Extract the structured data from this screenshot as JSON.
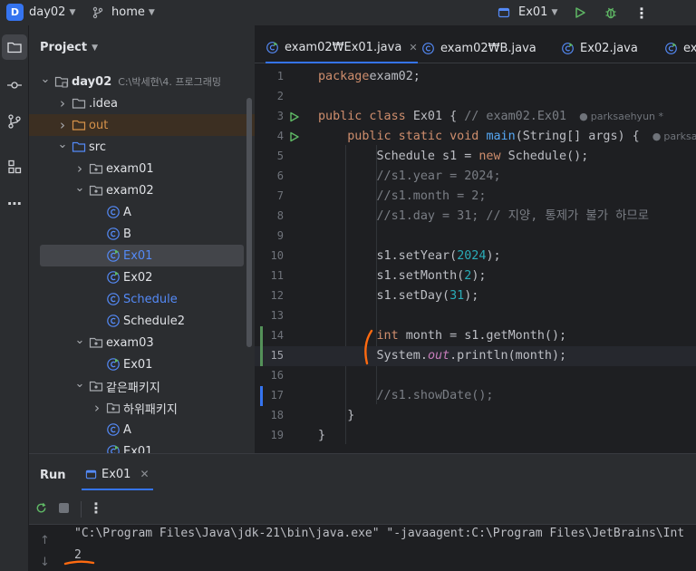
{
  "titlebar": {
    "project_badge": "D",
    "project_name": "day02",
    "branch": "home",
    "run_config": "Ex01",
    "colors": {
      "accent": "#3574f0",
      "run": "#5fb865"
    }
  },
  "project_panel": {
    "title": "Project",
    "tree": [
      {
        "label": "day02",
        "hint": "C:\\박세현\\4. 프로그래밍",
        "depth": 0,
        "arrow": "down",
        "icon": "module-folder-icon",
        "bold": true
      },
      {
        "label": ".idea",
        "depth": 1,
        "arrow": "right",
        "icon": "folder-icon"
      },
      {
        "label": "out",
        "depth": 1,
        "arrow": "right",
        "icon": "folder-excluded-icon",
        "orange": true
      },
      {
        "label": "src",
        "depth": 1,
        "arrow": "down",
        "icon": "source-folder-icon"
      },
      {
        "label": "exam01",
        "depth": 2,
        "arrow": "right",
        "icon": "package-icon"
      },
      {
        "label": "exam02",
        "depth": 2,
        "arrow": "down",
        "icon": "package-icon"
      },
      {
        "label": "A",
        "depth": 3,
        "icon": "class-icon"
      },
      {
        "label": "B",
        "depth": 3,
        "icon": "class-icon"
      },
      {
        "label": "Ex01",
        "depth": 3,
        "icon": "runnable-class-icon",
        "selected": true,
        "blue": true
      },
      {
        "label": "Ex02",
        "depth": 3,
        "icon": "runnable-class-icon"
      },
      {
        "label": "Schedule",
        "depth": 3,
        "icon": "class-icon",
        "blue": true
      },
      {
        "label": "Schedule2",
        "depth": 3,
        "icon": "class-icon"
      },
      {
        "label": "exam03",
        "depth": 2,
        "arrow": "down",
        "icon": "package-icon"
      },
      {
        "label": "Ex01",
        "depth": 3,
        "icon": "runnable-class-icon"
      },
      {
        "label": "같은패키지",
        "depth": 2,
        "arrow": "down",
        "icon": "package-icon"
      },
      {
        "label": "하위패키지",
        "depth": 3,
        "arrow": "right",
        "icon": "package-icon"
      },
      {
        "label": "A",
        "depth": 3,
        "icon": "class-icon"
      },
      {
        "label": "Ex01",
        "depth": 3,
        "icon": "runnable-class-icon"
      }
    ]
  },
  "editor": {
    "tabs": [
      {
        "label": "exam02₩Ex01.java",
        "active": true,
        "closable": true
      },
      {
        "label": "exam02₩B.java"
      },
      {
        "label": "Ex02.java"
      },
      {
        "label": "ex"
      }
    ],
    "author_hint": "parksaehyun *",
    "author_hint_short": "parksae",
    "lines": [
      {
        "n": "1",
        "code": [
          [
            "kw",
            "package"
          ],
          [
            "",
            "exam02;"
          ]
        ]
      },
      {
        "n": "2",
        "code": []
      },
      {
        "n": "3",
        "code": [
          [
            "kw",
            "public class "
          ],
          [
            "",
            "Ex01 { "
          ],
          [
            "cm",
            "// exam02.Ex01"
          ]
        ],
        "run": true,
        "hint": "author"
      },
      {
        "n": "4",
        "code": [
          [
            "",
            "    "
          ],
          [
            "kw",
            "public static void "
          ],
          [
            "fn",
            "main"
          ],
          [
            "",
            "(String[] args) {"
          ]
        ],
        "run": true,
        "hint": "author_short"
      },
      {
        "n": "5",
        "code": [
          [
            "",
            "        Schedule s1 = "
          ],
          [
            "kw",
            "new "
          ],
          [
            "",
            "Schedule();"
          ]
        ]
      },
      {
        "n": "6",
        "code": [
          [
            "cm",
            "        //s1.year = 2024;"
          ]
        ]
      },
      {
        "n": "7",
        "code": [
          [
            "cm",
            "        //s1.month = 2;"
          ]
        ]
      },
      {
        "n": "8",
        "code": [
          [
            "cm",
            "        //s1.day = 31; // 지양, 통제가 불가 하므로"
          ]
        ]
      },
      {
        "n": "9",
        "code": []
      },
      {
        "n": "10",
        "code": [
          [
            "",
            "        s1.setYear("
          ],
          [
            "num",
            "2024"
          ],
          [
            "",
            ");"
          ]
        ]
      },
      {
        "n": "11",
        "code": [
          [
            "",
            "        s1.setMonth("
          ],
          [
            "num",
            "2"
          ],
          [
            "",
            ");"
          ]
        ]
      },
      {
        "n": "12",
        "code": [
          [
            "",
            "        s1.setDay("
          ],
          [
            "num",
            "31"
          ],
          [
            "",
            ");"
          ]
        ]
      },
      {
        "n": "13",
        "code": []
      },
      {
        "n": "14",
        "code": [
          [
            "kw",
            "        int "
          ],
          [
            "",
            "month = s1.getMonth();"
          ]
        ]
      },
      {
        "n": "15",
        "code": [
          [
            "",
            "        System."
          ],
          [
            "st",
            "out"
          ],
          [
            "",
            ".println(month);"
          ]
        ],
        "current": true
      },
      {
        "n": "16",
        "code": []
      },
      {
        "n": "17",
        "code": [
          [
            "cm",
            "        //s1.showDate();"
          ]
        ]
      },
      {
        "n": "18",
        "code": [
          [
            "",
            "    }"
          ]
        ]
      },
      {
        "n": "19",
        "code": [
          [
            "",
            "}"
          ]
        ]
      }
    ]
  },
  "run_panel": {
    "title": "Run",
    "tab": "Ex01",
    "output": [
      "\"C:\\Program Files\\Java\\jdk-21\\bin\\java.exe\" \"-javaagent:C:\\Program Files\\JetBrains\\Int",
      "2"
    ],
    "annotation_color": "#ff6a10"
  }
}
